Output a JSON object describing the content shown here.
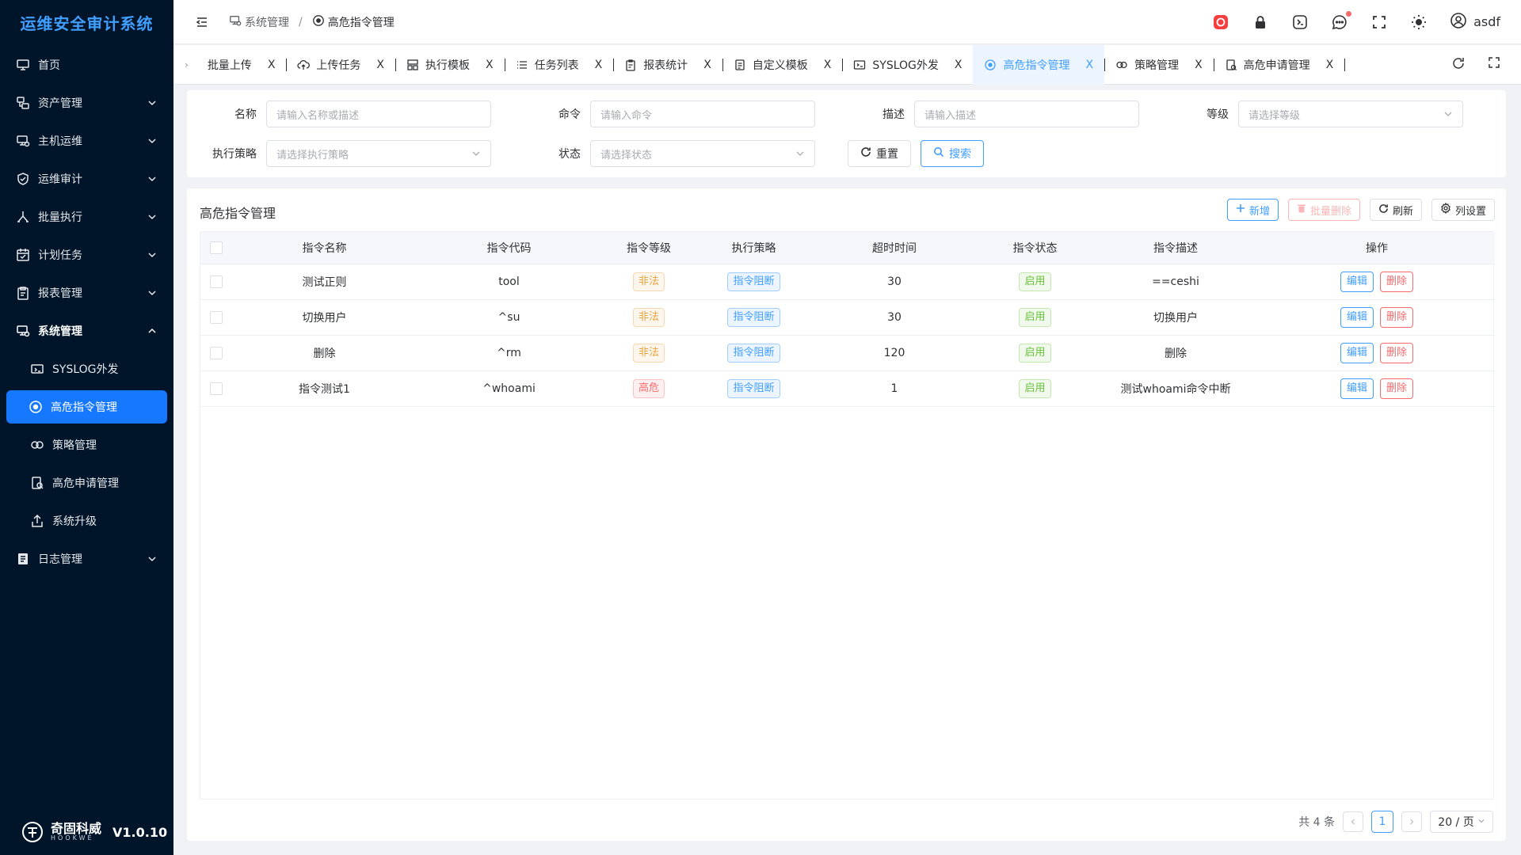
{
  "app": {
    "title": "运维安全审计系统",
    "version": "V1.0.10",
    "brand_cn": "奇固科威",
    "brand_en": "HOOKWE"
  },
  "colors": {
    "sidebar_bg": "#001529",
    "primary": "#409eff",
    "danger": "#f56c6c",
    "warning": "#e6a23c",
    "success": "#67c23a"
  },
  "sidebar": {
    "items": [
      {
        "label": "首页",
        "icon": "monitor-icon",
        "expandable": false
      },
      {
        "label": "资产管理",
        "icon": "asset-icon",
        "expandable": true
      },
      {
        "label": "主机运维",
        "icon": "host-icon",
        "expandable": true
      },
      {
        "label": "运维审计",
        "icon": "shield-check-icon",
        "expandable": true
      },
      {
        "label": "批量执行",
        "icon": "branch-icon",
        "expandable": true
      },
      {
        "label": "计划任务",
        "icon": "calendar-check-icon",
        "expandable": true
      },
      {
        "label": "报表管理",
        "icon": "clipboard-icon",
        "expandable": true
      },
      {
        "label": "系统管理",
        "icon": "system-icon",
        "expandable": true,
        "expanded": true
      },
      {
        "label": "日志管理",
        "icon": "log-icon",
        "expandable": true
      }
    ],
    "system_children": [
      {
        "label": "SYSLOG外发",
        "icon": "syslog-icon"
      },
      {
        "label": "高危指令管理",
        "icon": "target-icon",
        "active": true
      },
      {
        "label": "策略管理",
        "icon": "link-icon"
      },
      {
        "label": "高危申请管理",
        "icon": "apply-icon"
      },
      {
        "label": "系统升级",
        "icon": "upgrade-icon"
      }
    ]
  },
  "header": {
    "breadcrumb": [
      "系统管理",
      "高危指令管理"
    ],
    "user": "asdf"
  },
  "tabs": [
    {
      "label": "批量上传",
      "icon": ""
    },
    {
      "label": "上传任务",
      "icon": "cloud-upload-icon"
    },
    {
      "label": "执行模板",
      "icon": "template-icon"
    },
    {
      "label": "任务列表",
      "icon": "list-icon"
    },
    {
      "label": "报表统计",
      "icon": "clipboard-icon"
    },
    {
      "label": "自定义模板",
      "icon": "document-icon"
    },
    {
      "label": "SYSLOG外发",
      "icon": "syslog-icon"
    },
    {
      "label": "高危指令管理",
      "icon": "target-icon",
      "active": true
    },
    {
      "label": "策略管理",
      "icon": "link-icon"
    },
    {
      "label": "高危申请管理",
      "icon": "apply-icon"
    }
  ],
  "tab_close": "X",
  "filters": {
    "name": {
      "label": "名称",
      "placeholder": "请输入名称或描述"
    },
    "command": {
      "label": "命令",
      "placeholder": "请输入命令"
    },
    "desc": {
      "label": "描述",
      "placeholder": "请输入描述"
    },
    "level": {
      "label": "等级",
      "placeholder": "请选择等级"
    },
    "policy": {
      "label": "执行策略",
      "placeholder": "请选择执行策略"
    },
    "status": {
      "label": "状态",
      "placeholder": "请选择状态"
    },
    "reset": "重置",
    "search": "搜索"
  },
  "main": {
    "title": "高危指令管理",
    "add": "新增",
    "batch_delete": "批量删除",
    "refresh": "刷新",
    "columns_setting": "列设置"
  },
  "table": {
    "headers": [
      "指令名称",
      "指令代码",
      "指令等级",
      "执行策略",
      "超时时间",
      "指令状态",
      "指令描述",
      "操作"
    ],
    "rows": [
      {
        "name": "测试正则",
        "code": "tool",
        "level": "非法",
        "level_type": "warning",
        "policy": "指令阻断",
        "timeout": "30",
        "status": "启用",
        "desc": "==ceshi"
      },
      {
        "name": "切换用户",
        "code": "^su",
        "level": "非法",
        "level_type": "warning",
        "policy": "指令阻断",
        "timeout": "30",
        "status": "启用",
        "desc": "切换用户"
      },
      {
        "name": "删除",
        "code": "^rm",
        "level": "非法",
        "level_type": "warning",
        "policy": "指令阻断",
        "timeout": "120",
        "status": "启用",
        "desc": "删除"
      },
      {
        "name": "指令测试1",
        "code": "^whoami",
        "level": "高危",
        "level_type": "danger",
        "policy": "指令阻断",
        "timeout": "1",
        "status": "启用",
        "desc": "测试whoami命令中断"
      }
    ],
    "edit": "编辑",
    "delete": "删除"
  },
  "pager": {
    "total": "共 4 条",
    "page": "1",
    "size": "20 / 页"
  }
}
